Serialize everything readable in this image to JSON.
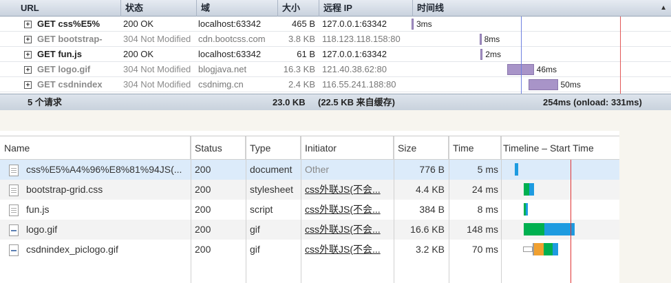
{
  "firebug": {
    "columns": [
      "URL",
      "状态",
      "域",
      "大小",
      "远程 IP",
      "时间线"
    ],
    "sort_icon": "▲",
    "rows": [
      {
        "url": "GET css%E5%",
        "status": "200 OK",
        "domain": "localhost:63342",
        "size": "465 B",
        "ip": "127.0.0.1:63342",
        "time": "3ms",
        "cached": false,
        "bar_start_ms": 0,
        "bar_ms": 3
      },
      {
        "url": "GET bootstrap-",
        "status": "304 Not Modified",
        "domain": "cdn.bootcss.com",
        "size": "3.8 KB",
        "ip": "118.123.118.158:80",
        "time": "8ms",
        "cached": true,
        "bar_start_ms": 116,
        "bar_ms": 2
      },
      {
        "url": "GET fun.js",
        "status": "200 OK",
        "domain": "localhost:63342",
        "size": "61 B",
        "ip": "127.0.0.1:63342",
        "time": "2ms",
        "cached": false,
        "bar_start_ms": 118,
        "bar_ms": 2
      },
      {
        "url": "GET logo.gif",
        "status": "304 Not Modified",
        "domain": "blogjava.net",
        "size": "16.3 KB",
        "ip": "121.40.38.62:80",
        "time": "46ms",
        "cached": true,
        "bar_start_ms": 163,
        "bar_ms": 46
      },
      {
        "url": "GET csdnindex",
        "status": "304 Not Modified",
        "domain": "csdnimg.cn",
        "size": "2.4 KB",
        "ip": "116.55.241.188:80",
        "time": "50ms",
        "cached": true,
        "bar_start_ms": 200,
        "bar_ms": 50
      }
    ],
    "summary": {
      "count": "5 个请求",
      "total_size": "23.0 KB",
      "cache_note": "(22.5 KB 来自缓存)",
      "time": "254ms (onload: 331ms)"
    }
  },
  "chrome": {
    "columns": [
      "Name",
      "Status",
      "Type",
      "Initiator",
      "Size",
      "Time",
      "Timeline – Start Time"
    ],
    "rows": [
      {
        "name": "css%E5%A4%96%E8%81%94JS(...",
        "status": "200",
        "type": "document",
        "initiator": "Other",
        "initiator_link": false,
        "size": "776 B",
        "time": "5 ms",
        "icon": "document-file-icon"
      },
      {
        "name": "bootstrap-grid.css",
        "status": "200",
        "type": "stylesheet",
        "initiator": "css外联JS(不会...",
        "initiator_link": true,
        "size": "4.4 KB",
        "time": "24 ms",
        "icon": "document-file-icon"
      },
      {
        "name": "fun.js",
        "status": "200",
        "type": "script",
        "initiator": "css外联JS(不会...",
        "initiator_link": true,
        "size": "384 B",
        "time": "8 ms",
        "icon": "document-file-icon"
      },
      {
        "name": "logo.gif",
        "status": "200",
        "type": "gif",
        "initiator": "css外联JS(不会...",
        "initiator_link": true,
        "size": "16.6 KB",
        "time": "148 ms",
        "icon": "image-file-icon"
      },
      {
        "name": "csdnindex_piclogo.gif",
        "status": "200",
        "type": "gif",
        "initiator": "css外联JS(不会...",
        "initiator_link": true,
        "size": "3.2 KB",
        "time": "70 ms",
        "icon": "image-file-icon"
      }
    ],
    "colors": {
      "waiting": "#00b050",
      "receiving": "#1e9be0",
      "stalled": "#9b9b9b",
      "proxy": "#f0a030",
      "dom_line": "#e03030"
    }
  }
}
